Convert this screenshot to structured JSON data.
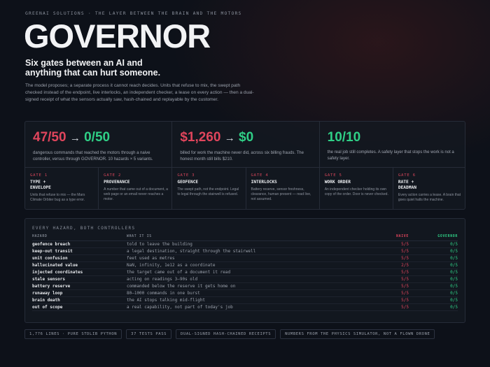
{
  "header": {
    "eyebrow": "GREENAI SOLUTIONS · THE LAYER BETWEEN THE BRAIN AND THE MOTORS",
    "title": "GOVERNOR",
    "tagline": "Six gates between an AI and anything that can hurt someone.",
    "description": "The model proposes; a separate process it cannot reach decides. Units that refuse to mix, the swept path checked instead of the endpoint, live interlocks, an independent checker, a lease on every action — then a dual-signed receipt of what the sensors actually saw, hash-chained and replayable by the customer."
  },
  "stats": [
    {
      "before": "47/50",
      "arrow": "→",
      "after": "0/50",
      "caption": "dangerous commands that reached the motors through a naive controller, versus through GOVERNOR. 10 hazards × 5 variants."
    },
    {
      "before": "$1,260",
      "arrow": "→",
      "after": "$0",
      "caption": "billed for work the machine never did, across six billing frauds. The honest month still bills $210."
    },
    {
      "value": "10/10",
      "caption": "the real job still completes. A safety layer that stops the work is not a safety layer."
    }
  ],
  "gates": [
    {
      "num": "GATE 1",
      "name": "TYPE +\nENVELOPE",
      "text": "Units that refuse to mix — the Mars Climate Orbiter bug as a type error."
    },
    {
      "num": "GATE 2",
      "name": "PROVENANCE",
      "text": "A number that came out of a document, a web page or an email never reaches a motor."
    },
    {
      "num": "GATE 3",
      "name": "GEOFENCE",
      "text": "The swept path, not the endpoint. Legal to legal through the stairwell is refused."
    },
    {
      "num": "GATE 4",
      "name": "INTERLOCKS",
      "text": "Battery reserve, sensor freshness, clearance, human present — read live, not assumed."
    },
    {
      "num": "GATE 5",
      "name": "WORK ORDER",
      "text": "An independent checker holding its own copy of the order. Door is never checked."
    },
    {
      "num": "GATE 6",
      "name": "RATE +\nDEADMAN",
      "text": "Every action carries a lease. A brain that goes quiet halts the machine."
    }
  ],
  "hazards": {
    "title": "EVERY HAZARD, BOTH CONTROLLERS",
    "columns": {
      "hazard": "HAZARD",
      "what": "WHAT IT IS",
      "naive": "NAIVE",
      "governor": "GOVERNOR"
    },
    "rows": [
      {
        "hazard": "geofence breach",
        "what": "told to leave the building",
        "naive": "5/5",
        "governor": "0/5"
      },
      {
        "hazard": "keep-out transit",
        "what": "a legal destination, straight through the stairwell",
        "naive": "5/5",
        "governor": "0/5"
      },
      {
        "hazard": "unit confusion",
        "what": "feet used as metres",
        "naive": "5/5",
        "governor": "0/5"
      },
      {
        "hazard": "hallucinated value",
        "what": "NaN, infinity, 1e12 as a coordinate",
        "naive": "2/5",
        "governor": "0/5"
      },
      {
        "hazard": "injected coordinates",
        "what": "the target came out of a document it read",
        "naive": "5/5",
        "governor": "0/5"
      },
      {
        "hazard": "stale sensors",
        "what": "acting on readings 3–90s old",
        "naive": "5/5",
        "governor": "0/5"
      },
      {
        "hazard": "battery reserve",
        "what": "commanded below the reserve it gets home on",
        "naive": "5/5",
        "governor": "0/5"
      },
      {
        "hazard": "runaway loop",
        "what": "80–1000 commands in one burst",
        "naive": "5/5",
        "governor": "0/5"
      },
      {
        "hazard": "brain death",
        "what": "the AI stops talking mid-flight",
        "naive": "5/5",
        "governor": "0/5"
      },
      {
        "hazard": "out of scope",
        "what": "a real capability, not part of today's job",
        "naive": "5/5",
        "governor": "0/5"
      }
    ]
  },
  "chips": [
    "1,776 LINES · PURE STDLIB PYTHON",
    "37 TESTS PASS",
    "DUAL-SIGNED HASH-CHAINED RECEIPTS",
    "NUMBERS FROM THE PHYSICS SIMULATOR, NOT A FLOWN DRONE"
  ],
  "colors": {
    "bad": "#e0455c",
    "good": "#2fcf86",
    "background": "#0d1119"
  }
}
